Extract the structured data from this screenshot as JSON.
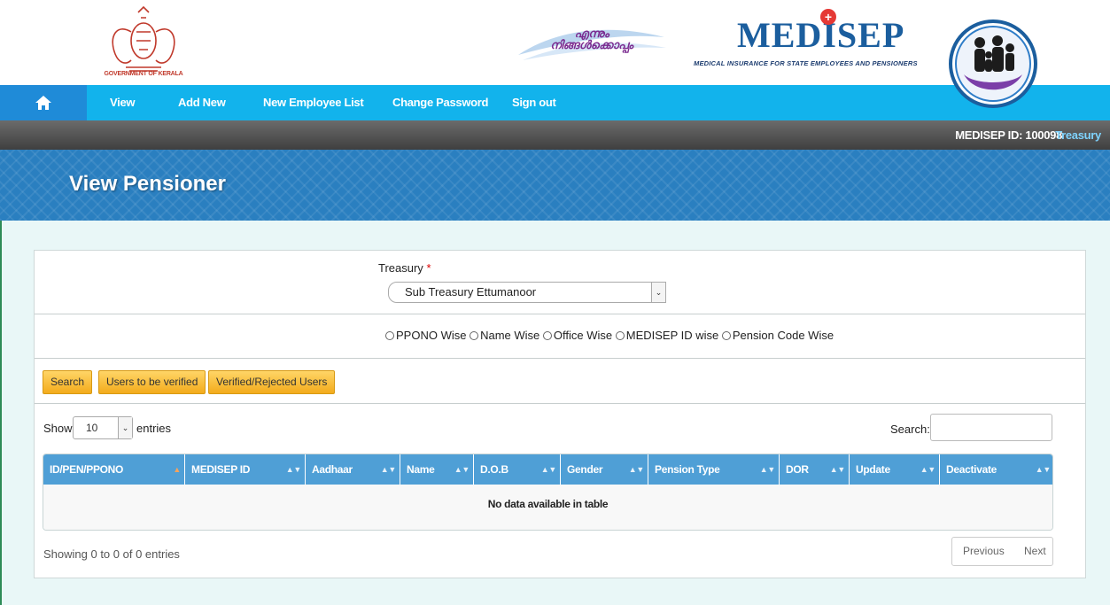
{
  "header": {
    "gov_caption": "GOVERNMENT OF KERALA",
    "slogan": "എന്നും നിങ്ങൾക്കൊപ്പം",
    "brand": "MEDISEP",
    "brand_subtitle": "MEDICAL INSURANCE FOR STATE EMPLOYEES AND PENSIONERS"
  },
  "nav": {
    "items": [
      {
        "label": "View"
      },
      {
        "label": "Add New"
      },
      {
        "label": "New Employee List"
      },
      {
        "label": "Change Password"
      },
      {
        "label": "Sign out"
      }
    ]
  },
  "userbar": {
    "medisep_id": "MEDISEP ID: 100098",
    "office": "Treasury"
  },
  "page": {
    "title": "View Pensioner"
  },
  "filter": {
    "treasury_label": "Treasury",
    "required_mark": "*",
    "treasury_value": "Sub Treasury Ettumanoor",
    "radio_options": [
      "PPONO Wise",
      "Name Wise",
      "Office Wise",
      "MEDISEP ID wise",
      "Pension Code Wise"
    ]
  },
  "buttons": {
    "search": "Search",
    "users_to_verify": "Users to be verified",
    "verified_rejected": "Verified/Rejected Users"
  },
  "table": {
    "show_label": "Show",
    "page_size": "10",
    "entries_label": "entries",
    "search_label": "Search:",
    "columns": [
      "ID/PEN/PPONO",
      "MEDISEP ID",
      "Aadhaar",
      "Name",
      "D.O.B",
      "Gender",
      "Pension Type",
      "DOR",
      "Update",
      "Deactivate"
    ],
    "empty_message": "No data available in table",
    "info": "Showing 0 to 0 of 0 entries",
    "previous": "Previous",
    "next": "Next"
  },
  "colors": {
    "nav_bg": "#12b3ec",
    "banner_bg": "#2a7fc0",
    "button_bg": "#f3ab1c",
    "table_header_bg": "#4f9fd6"
  }
}
